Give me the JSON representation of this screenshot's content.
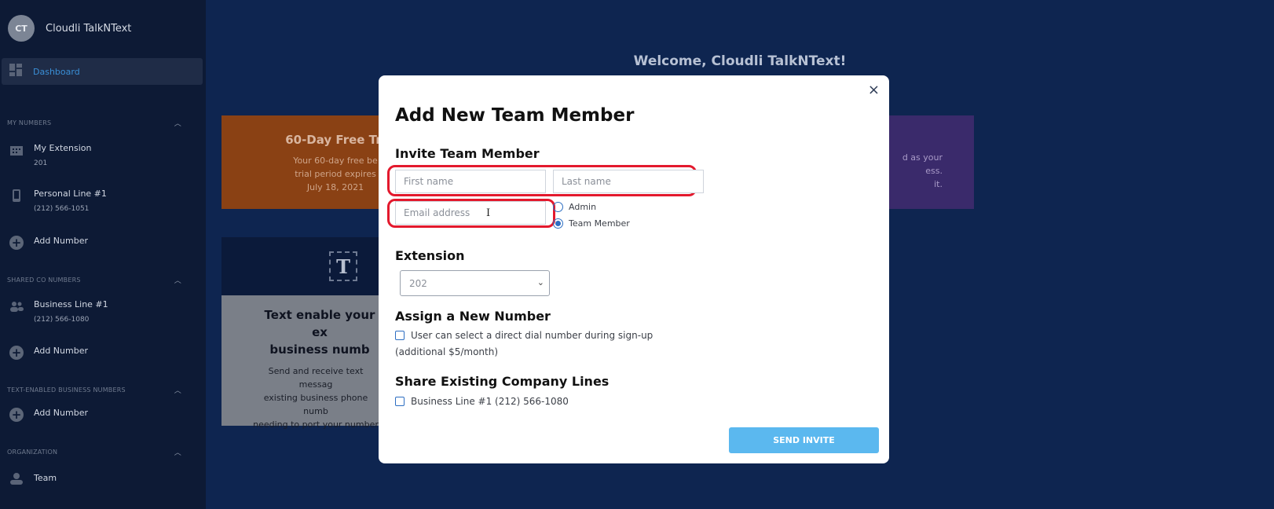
{
  "sidebar": {
    "avatar_initials": "CT",
    "user_name": "Cloudli TalkNText",
    "nav_active": "Dashboard",
    "sections": {
      "my_numbers": "MY NUMBERS",
      "shared": "SHARED CO NUMBERS",
      "text_enabled": "TEXT-ENABLED BUSINESS NUMBERS",
      "organization": "ORGANIZATION"
    },
    "items": {
      "my_extension": {
        "label": "My Extension",
        "sub": "201"
      },
      "personal_line": {
        "label": "Personal Line #1",
        "sub": "(212) 566-1051"
      },
      "add_number_1": "Add Number",
      "business_line": {
        "label": "Business Line #1",
        "sub": "(212) 566-1080"
      },
      "add_number_2": "Add Number",
      "add_number_3": "Add Number",
      "team": "Team"
    }
  },
  "main": {
    "welcome": "Welcome, Cloudli TalkNText!",
    "trial_card": {
      "title": "60-Day Free Tri",
      "line1": "Your 60-day free be",
      "line2": "trial period expires",
      "line3": "July 18, 2021"
    },
    "purple_card": {
      "line1": "d as your",
      "line2": "ess.",
      "line3": "it."
    },
    "text_card": {
      "icon_letter": "T",
      "title1": "Text enable your ex",
      "title2": "business numb",
      "p1": "Send and receive text messag",
      "p2": "existing business phone numb",
      "p3": "needing to port your number"
    }
  },
  "modal": {
    "close": "×",
    "title": "Add New Team Member",
    "invite_heading": "Invite Team Member",
    "first_name_placeholder": "First name",
    "last_name_placeholder": "Last name",
    "email_placeholder": "Email address",
    "role_admin": "Admin",
    "role_team_member": "Team Member",
    "selected_role": "Team Member",
    "extension_heading": "Extension",
    "extension_value": "202",
    "assign_heading": "Assign a New Number",
    "assign_checkbox": "User can select a direct dial number during sign-up",
    "assign_sub": "(additional $5/month)",
    "share_heading": "Share Existing Company Lines",
    "share_checkbox": "Business Line #1 (212) 566-1080",
    "send_button": "SEND INVITE"
  },
  "colors": {
    "highlight": "#e3192d",
    "primary_button": "#5bb8ef",
    "accent": "#2d6ec2"
  }
}
